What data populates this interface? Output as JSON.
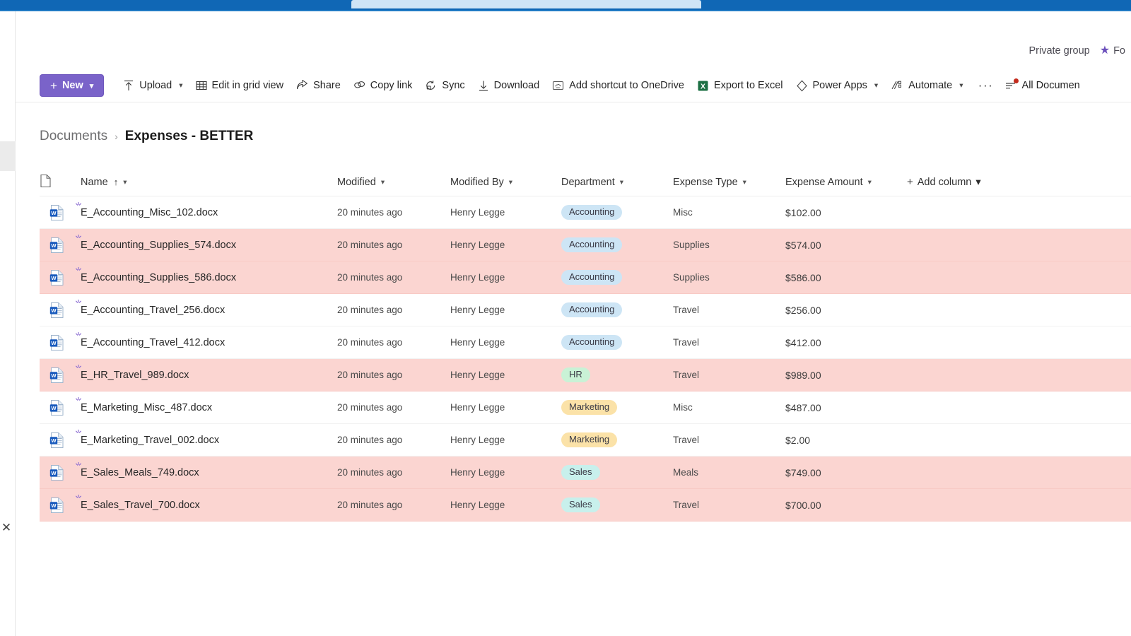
{
  "suite": {
    "search_placeholder": "",
    "bar_color": "#1067b5"
  },
  "header": {
    "privacy_label": "Private group",
    "follow_label": "Fo",
    "star_icon": "star-icon"
  },
  "toolbar": {
    "new_label": "New",
    "items": [
      {
        "id": "upload",
        "label": "Upload",
        "icon": "upload-icon",
        "chevron": true
      },
      {
        "id": "grid",
        "label": "Edit in grid view",
        "icon": "grid-icon",
        "chevron": false
      },
      {
        "id": "share",
        "label": "Share",
        "icon": "share-icon",
        "chevron": false
      },
      {
        "id": "copylink",
        "label": "Copy link",
        "icon": "link-icon",
        "chevron": false
      },
      {
        "id": "sync",
        "label": "Sync",
        "icon": "sync-icon",
        "chevron": false
      },
      {
        "id": "download",
        "label": "Download",
        "icon": "download-icon",
        "chevron": false
      },
      {
        "id": "shortcut",
        "label": "Add shortcut to OneDrive",
        "icon": "onedrive-shortcut-icon",
        "chevron": false
      },
      {
        "id": "excel",
        "label": "Export to Excel",
        "icon": "excel-icon",
        "chevron": false
      },
      {
        "id": "powerapps",
        "label": "Power Apps",
        "icon": "power-apps-icon",
        "chevron": true
      },
      {
        "id": "automate",
        "label": "Automate",
        "icon": "power-automate-icon",
        "chevron": true
      }
    ],
    "overflow_label": "···",
    "view_label": "All Documen"
  },
  "breadcrumb": {
    "root": "Documents",
    "separator": "›",
    "current": "Expenses - BETTER"
  },
  "columns": [
    {
      "key": "name",
      "label": "Name",
      "sorted": "ascending"
    },
    {
      "key": "mod",
      "label": "Modified"
    },
    {
      "key": "by",
      "label": "Modified By"
    },
    {
      "key": "dept",
      "label": "Department"
    },
    {
      "key": "type",
      "label": "Expense Type"
    },
    {
      "key": "amount",
      "label": "Expense Amount"
    }
  ],
  "add_column_label": "Add column",
  "rows": [
    {
      "name": "E_Accounting_Misc_102.docx",
      "modified": "20 minutes ago",
      "modified_by": "Henry Legge",
      "department": "Accounting",
      "dept_class": "accounting",
      "expense_type": "Misc",
      "amount": "$102.00",
      "flagged": false
    },
    {
      "name": "E_Accounting_Supplies_574.docx",
      "modified": "20 minutes ago",
      "modified_by": "Henry Legge",
      "department": "Accounting",
      "dept_class": "accounting",
      "expense_type": "Supplies",
      "amount": "$574.00",
      "flagged": true
    },
    {
      "name": "E_Accounting_Supplies_586.docx",
      "modified": "20 minutes ago",
      "modified_by": "Henry Legge",
      "department": "Accounting",
      "dept_class": "accounting",
      "expense_type": "Supplies",
      "amount": "$586.00",
      "flagged": true
    },
    {
      "name": "E_Accounting_Travel_256.docx",
      "modified": "20 minutes ago",
      "modified_by": "Henry Legge",
      "department": "Accounting",
      "dept_class": "accounting",
      "expense_type": "Travel",
      "amount": "$256.00",
      "flagged": false
    },
    {
      "name": "E_Accounting_Travel_412.docx",
      "modified": "20 minutes ago",
      "modified_by": "Henry Legge",
      "department": "Accounting",
      "dept_class": "accounting",
      "expense_type": "Travel",
      "amount": "$412.00",
      "flagged": false
    },
    {
      "name": "E_HR_Travel_989.docx",
      "modified": "20 minutes ago",
      "modified_by": "Henry Legge",
      "department": "HR",
      "dept_class": "hr",
      "expense_type": "Travel",
      "amount": "$989.00",
      "flagged": true
    },
    {
      "name": "E_Marketing_Misc_487.docx",
      "modified": "20 minutes ago",
      "modified_by": "Henry Legge",
      "department": "Marketing",
      "dept_class": "marketing",
      "expense_type": "Misc",
      "amount": "$487.00",
      "flagged": false
    },
    {
      "name": "E_Marketing_Travel_002.docx",
      "modified": "20 minutes ago",
      "modified_by": "Henry Legge",
      "department": "Marketing",
      "dept_class": "marketing",
      "expense_type": "Travel",
      "amount": "$2.00",
      "flagged": false
    },
    {
      "name": "E_Sales_Meals_749.docx",
      "modified": "20 minutes ago",
      "modified_by": "Henry Legge",
      "department": "Sales",
      "dept_class": "sales",
      "expense_type": "Meals",
      "amount": "$749.00",
      "flagged": true
    },
    {
      "name": "E_Sales_Travel_700.docx",
      "modified": "20 minutes ago",
      "modified_by": "Henry Legge",
      "department": "Sales",
      "dept_class": "sales",
      "expense_type": "Travel",
      "amount": "$700.00",
      "flagged": true
    }
  ],
  "colors": {
    "accent_purple": "#7a63c9",
    "flag_row": "#fbd5d1",
    "suite_blue": "#1067b5",
    "pill_accounting": "#cde5f5",
    "pill_hr": "#c9f2d6",
    "pill_marketing": "#fbe2a8",
    "pill_sales": "#c8f0ec",
    "red_dot": "#c42b1c"
  }
}
